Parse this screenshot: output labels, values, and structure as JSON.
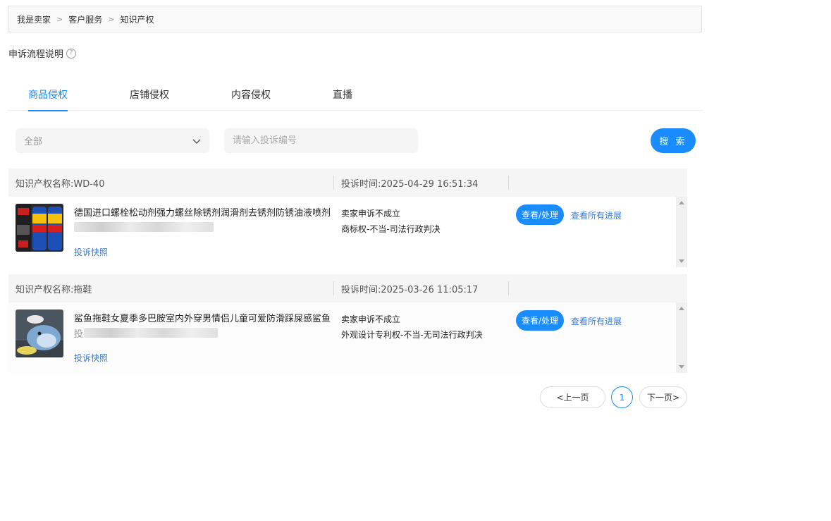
{
  "breadcrumb": [
    "我是卖家",
    "客户服务",
    "知识产权"
  ],
  "process_label": "申诉流程说明",
  "tabs": [
    {
      "label": "商品侵权",
      "active": true
    },
    {
      "label": "店铺侵权",
      "active": false
    },
    {
      "label": "内容侵权",
      "active": false
    },
    {
      "label": "直播",
      "active": false
    }
  ],
  "filter": {
    "select_value": "全部",
    "search_placeholder": "请输入投诉编号",
    "search_button": "搜 索"
  },
  "cards": [
    {
      "ip_name": "知识产权名称:WD-40",
      "time": "投诉时间:2025-04-29 16:51:34",
      "title": "德国进口螺栓松动剂强力螺丝除锈剂润滑剂去锈剂防锈油液喷剂",
      "blur_prefix": "",
      "snapshot": "投诉快照",
      "status": "卖家申诉不成立",
      "reason": "商标权-不当-司法行政判决",
      "view_button": "查看/处理",
      "progress_link": "查看所有进展"
    },
    {
      "ip_name": "知识产权名称:拖鞋",
      "time": "投诉时间:2025-03-26 11:05:17",
      "title": "鲨鱼拖鞋女夏季多巴胺室内外穿男情侣儿童可爱防滑踩屎感鲨鱼",
      "blur_prefix": "投",
      "snapshot": "投诉快照",
      "status": "卖家申诉不成立",
      "reason": "外观设计专利权-不当-无司法行政判决",
      "view_button": "查看/处理",
      "progress_link": "查看所有进展"
    }
  ],
  "pagination": {
    "prev": "<上一页",
    "current": "1",
    "next": "下一页>"
  },
  "colors": {
    "accent": "#1a8cff",
    "link": "#3a7bd5"
  }
}
